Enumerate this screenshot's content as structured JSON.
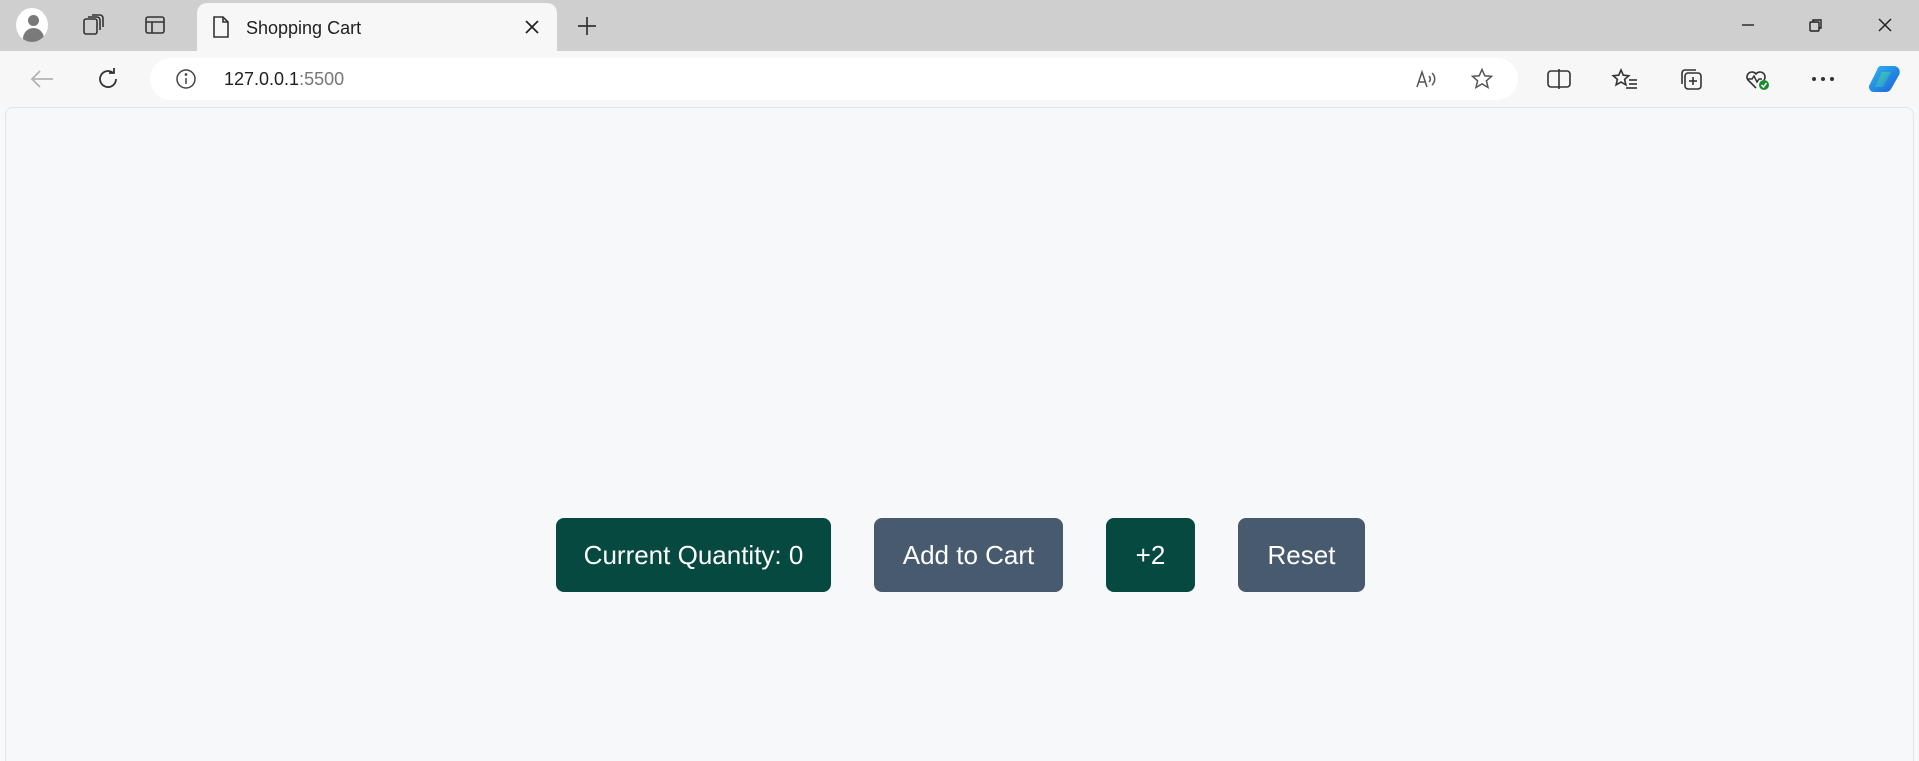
{
  "browser": {
    "tab": {
      "title": "Shopping Cart"
    },
    "address": {
      "host": "127.0.0.1",
      "port": ":5500"
    }
  },
  "icons": {
    "profile": "profile-avatar-icon",
    "workspaces": "workspaces-icon",
    "vertical_tabs": "vertical-tabs-icon",
    "page": "page-document-icon",
    "close_tab": "close-icon",
    "new_tab": "plus-icon",
    "back": "back-arrow-icon",
    "reload": "reload-icon",
    "site_info": "info-icon",
    "read_aloud": "read-aloud-icon",
    "favorite": "star-icon",
    "split_screen": "split-screen-icon",
    "favorites": "favorites-icon",
    "collections": "collections-icon",
    "browser_essentials": "health-icon",
    "more": "more-icon",
    "copilot": "copilot-icon"
  },
  "controls": {
    "quantity_label": "Current Quantity: 0",
    "add_label": "Add to Cart",
    "plus_two_label": "+2",
    "reset_label": "Reset"
  },
  "colors": {
    "primary_button": "#064940",
    "secondary_button": "#475a6e",
    "page_background": "#f7f8f9"
  }
}
